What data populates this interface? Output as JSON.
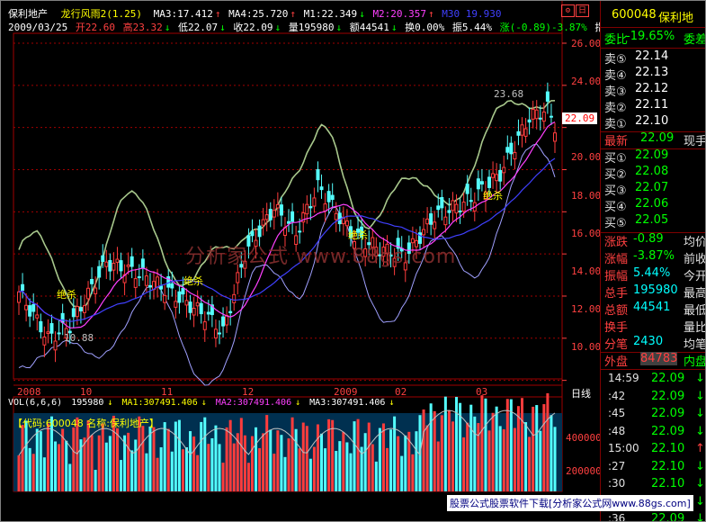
{
  "header": {
    "stock_name": "保利地产",
    "indicator": "龙行风雨2(1.25)",
    "ma3": "MA3:17.412",
    "ma4": "MA4:25.720",
    "m1": "M1:22.349",
    "m2": "M2:20.357",
    "m30": "M30 19.930",
    "date": "2009/03/25",
    "open": "开22.60",
    "high": "高23.32",
    "low": "低22.07",
    "close": "收22.09",
    "vol": "量195980",
    "amount": "额44541",
    "turnover": "换0.00%",
    "amplitude": "振5.44%",
    "change": "涨(-0.89)-3.87%",
    "index_btn": "指数"
  },
  "chart": {
    "y_ticks": [
      "26.00",
      "24.00",
      "22.00",
      "20.00",
      "18.00",
      "16.00",
      "14.00",
      "12.00",
      "10.00"
    ],
    "x_ticks": [
      "2008",
      "10",
      "11",
      "12",
      "2009",
      "02",
      "03"
    ],
    "period": "日线",
    "high_annot": "23.68",
    "low_annot": "10.88",
    "price_badge": "22.09",
    "watermark": "分析家公式 www.88gs.com",
    "signals": [
      "绝杀",
      "绝杀",
      "绝杀",
      "绝杀"
    ],
    "colors": {
      "up": "#ff3c3c",
      "down": "#54ffff",
      "ma_pink": "#ff40ff",
      "ma_blue": "#4040ff",
      "band_green": "#a8c88c",
      "band_violet": "#a0a0ff"
    }
  },
  "volume": {
    "label": "VOL(6,6,6)",
    "value": "195980",
    "ma1": "MA1:307491.406",
    "ma2": "MA2:307491.406",
    "ma3": "MA3:307491.406",
    "code_line": "【代码:600048 名称:保利地产】",
    "ticks": [
      "400000",
      "200000"
    ]
  },
  "panel": {
    "code": "600048",
    "name": "保利地",
    "ratio_label": "委比",
    "ratio_value": "-19.65%",
    "ratio_extra": "委差",
    "sells": [
      {
        "label": "卖⑤",
        "price": "22.14"
      },
      {
        "label": "卖④",
        "price": "22.13"
      },
      {
        "label": "卖③",
        "price": "22.12"
      },
      {
        "label": "卖②",
        "price": "22.11"
      },
      {
        "label": "卖①",
        "price": "22.10"
      }
    ],
    "latest_label": "最新",
    "latest_value": "22.09",
    "latest_extra": "现手",
    "buys": [
      {
        "label": "买①",
        "price": "22.09"
      },
      {
        "label": "买②",
        "price": "22.08"
      },
      {
        "label": "买③",
        "price": "22.07"
      },
      {
        "label": "买④",
        "price": "22.06"
      },
      {
        "label": "买⑤",
        "price": "22.05"
      }
    ],
    "stats": [
      {
        "label": "涨跌",
        "value": "-0.89",
        "extra": "均价"
      },
      {
        "label": "涨幅",
        "value": "-3.87%",
        "extra": "前收"
      },
      {
        "label": "振幅",
        "value": "5.44%",
        "extra": "今开"
      },
      {
        "label": "总手",
        "value": "195980",
        "extra": "最高"
      },
      {
        "label": "总额",
        "value": "44541",
        "extra": "最低"
      },
      {
        "label": "换手",
        "value": "",
        "extra": "量比"
      },
      {
        "label": "分笔",
        "value": "2430",
        "extra": "均笔"
      }
    ],
    "outer_label": "外盘",
    "outer_value": "84783",
    "inner_label": "内盘",
    "ticks": [
      {
        "time": "14:59",
        "price": "22.09",
        "arrow": "↓"
      },
      {
        "time": ":42",
        "price": "22.09",
        "arrow": "↓"
      },
      {
        "time": ":45",
        "price": "22.09",
        "arrow": "↓"
      },
      {
        "time": ":48",
        "price": "22.09",
        "arrow": "↓"
      },
      {
        "time": "15:00",
        "price": "22.10",
        "arrow": "↑"
      },
      {
        "time": ":27",
        "price": "22.10",
        "arrow": "↓"
      },
      {
        "time": ":30",
        "price": "22.10",
        "arrow": "↓"
      },
      {
        "time": ":33",
        "price": "22.09",
        "arrow": "↓"
      },
      {
        "time": ":36",
        "price": "22.09",
        "arrow": "↓"
      }
    ]
  },
  "footer": "股票公式股票软件下载[分析家公式网www.88gs.com]"
}
